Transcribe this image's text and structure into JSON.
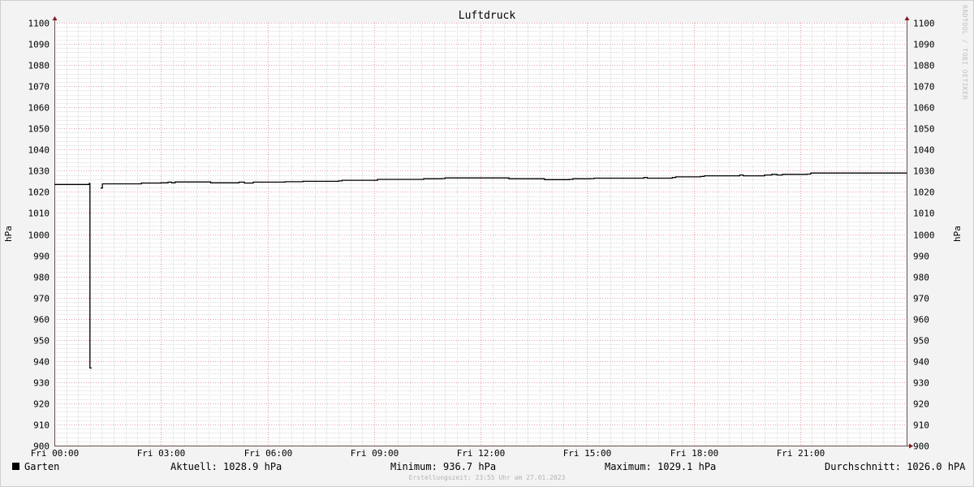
{
  "chart_data": {
    "type": "line",
    "title": "Luftdruck",
    "ylabel": "hPa",
    "ylim": [
      900,
      1100
    ],
    "yticks": [
      900,
      910,
      920,
      930,
      940,
      950,
      960,
      970,
      980,
      990,
      1000,
      1010,
      1020,
      1030,
      1040,
      1050,
      1060,
      1070,
      1080,
      1090,
      1100
    ],
    "xlim": [
      "Fri 00:00",
      "Fri 24:00"
    ],
    "xticks": [
      {
        "label": "Fri 00:00",
        "hour": 0
      },
      {
        "label": "Fri 03:00",
        "hour": 3
      },
      {
        "label": "Fri 06:00",
        "hour": 6
      },
      {
        "label": "Fri 09:00",
        "hour": 9
      },
      {
        "label": "Fri 12:00",
        "hour": 12
      },
      {
        "label": "Fri 15:00",
        "hour": 15
      },
      {
        "label": "Fri 18:00",
        "hour": 18
      },
      {
        "label": "Fri 21:00",
        "hour": 21
      }
    ],
    "grid": true,
    "legend_position": "bottom",
    "series": [
      {
        "name": "Garten",
        "color": "#000000",
        "points": [
          [
            0.0,
            1023.5
          ],
          [
            0.95,
            1023.5
          ],
          [
            0.98,
            1024.0
          ],
          [
            1.0,
            936.7
          ],
          [
            1.05,
            936.7
          ],
          null,
          [
            1.3,
            1021.8
          ],
          [
            1.35,
            1023.8
          ],
          [
            2.4,
            1023.8
          ],
          [
            2.45,
            1024.2
          ],
          [
            3.0,
            1024.3
          ],
          [
            3.2,
            1024.6
          ],
          [
            3.3,
            1024.3
          ],
          [
            3.4,
            1024.7
          ],
          [
            4.3,
            1024.7
          ],
          [
            4.4,
            1024.3
          ],
          [
            5.1,
            1024.3
          ],
          [
            5.2,
            1024.6
          ],
          [
            5.35,
            1024.2
          ],
          [
            5.6,
            1024.6
          ],
          [
            6.5,
            1024.8
          ],
          [
            7.0,
            1025.0
          ],
          [
            8.0,
            1025.2
          ],
          [
            8.1,
            1025.5
          ],
          [
            9.0,
            1025.5
          ],
          [
            9.1,
            1025.9
          ],
          [
            10.3,
            1025.9
          ],
          [
            10.4,
            1026.2
          ],
          [
            10.9,
            1026.3
          ],
          [
            11.0,
            1026.6
          ],
          [
            12.7,
            1026.6
          ],
          [
            12.8,
            1026.2
          ],
          [
            13.7,
            1026.2
          ],
          [
            13.8,
            1025.8
          ],
          [
            14.5,
            1025.9
          ],
          [
            14.6,
            1026.2
          ],
          [
            15.1,
            1026.3
          ],
          [
            15.2,
            1026.5
          ],
          [
            16.5,
            1026.5
          ],
          [
            16.6,
            1026.8
          ],
          [
            16.7,
            1026.5
          ],
          [
            17.4,
            1026.8
          ],
          [
            17.5,
            1027.1
          ],
          [
            18.2,
            1027.3
          ],
          [
            18.3,
            1027.6
          ],
          [
            19.2,
            1027.6
          ],
          [
            19.3,
            1028.0
          ],
          [
            19.4,
            1027.6
          ],
          [
            20.0,
            1028.0
          ],
          [
            20.2,
            1028.3
          ],
          [
            20.35,
            1028.0
          ],
          [
            20.5,
            1028.3
          ],
          [
            21.2,
            1028.4
          ],
          [
            21.3,
            1028.9
          ],
          [
            24.0,
            1028.9
          ]
        ]
      }
    ],
    "stats": {
      "current": "Aktuell: 1028.9 hPa",
      "minimum": "Minimum: 936.7 hPa",
      "maximum": "Maximum: 1029.1 hPa",
      "average": "Durchschnitt: 1026.0 hPA"
    },
    "footer": "Erstellungszeit: 23:55 Uhr am 27.01.2023",
    "watermark": "RRDTOOL / TOBI OETIKER"
  }
}
